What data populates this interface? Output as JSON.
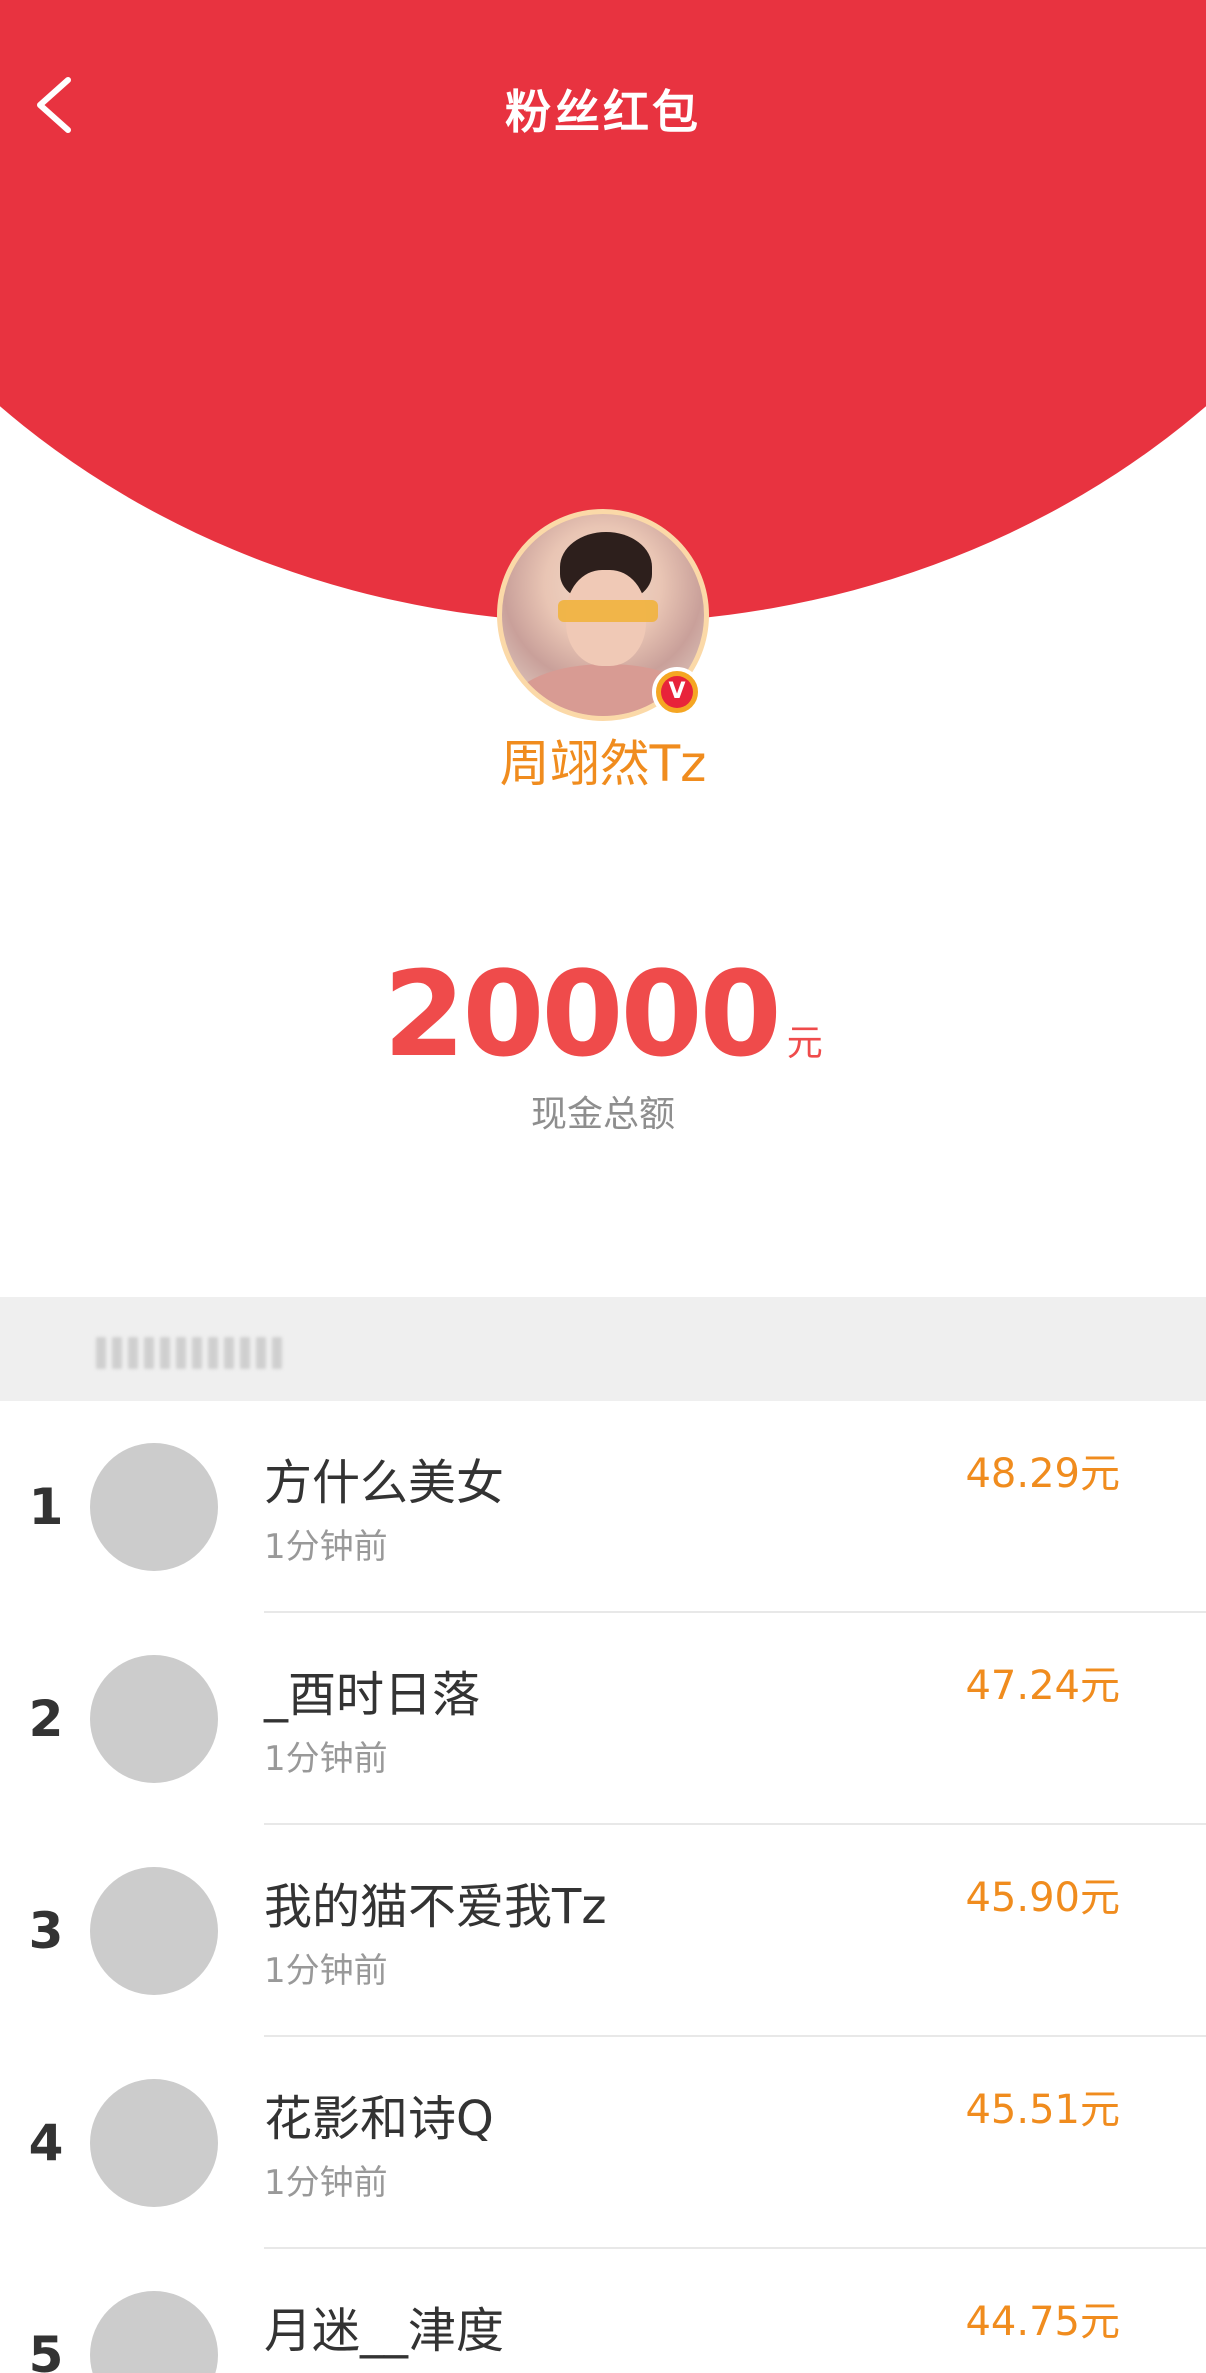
{
  "header": {
    "title": "粉丝红包",
    "back_icon": "chevron-left-icon",
    "colors": {
      "red": "#e83340",
      "cream": "#fde3b6"
    }
  },
  "sender": {
    "name": "周翊然Tz",
    "verified_badge": "V"
  },
  "total": {
    "amount": "20000",
    "unit": "元",
    "label": "现金总额",
    "color": "#ef4b4b"
  },
  "list": {
    "items": [
      {
        "rank": "1",
        "name": "方什么美女",
        "time": "1分钟前",
        "amount": "48.29元"
      },
      {
        "rank": "2",
        "name": "_酉时日落",
        "time": "1分钟前",
        "amount": "47.24元"
      },
      {
        "rank": "3",
        "name": "我的猫不爱我Tz",
        "time": "1分钟前",
        "amount": "45.90元"
      },
      {
        "rank": "4",
        "name": "花影和诗Q",
        "time": "1分钟前",
        "amount": "45.51元"
      },
      {
        "rank": "5",
        "name": "月迷__津度",
        "time": "",
        "amount": "44.75元"
      }
    ],
    "accent_color": "#f08c1e"
  }
}
